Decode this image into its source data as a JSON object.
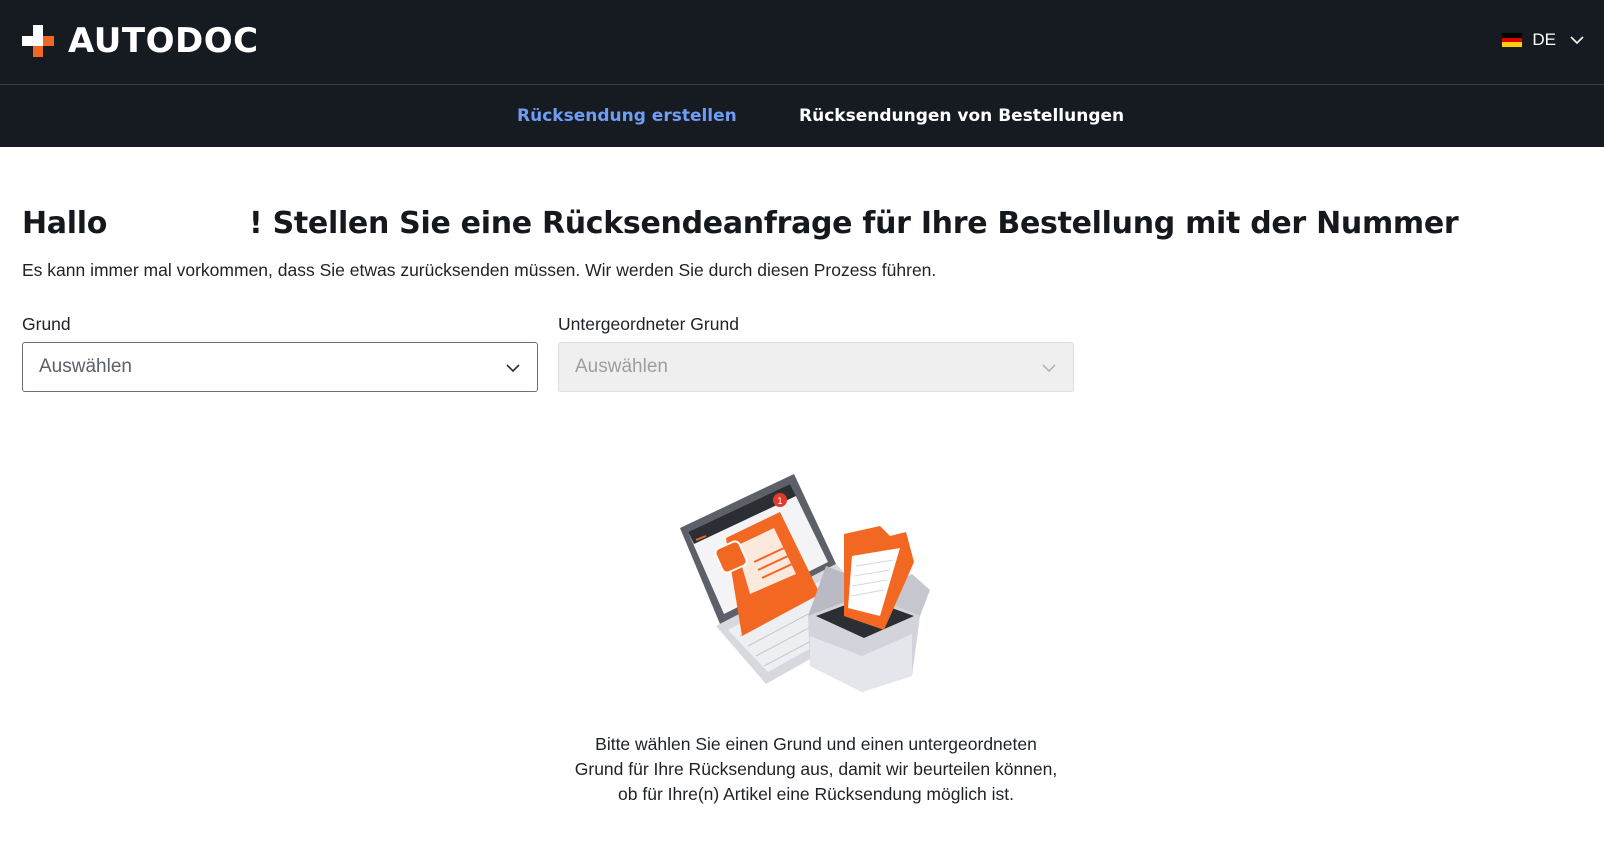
{
  "header": {
    "brand": "AUTODOC",
    "language": {
      "code": "DE",
      "flag_colors": [
        "#000000",
        "#dd0000",
        "#ffce00"
      ]
    }
  },
  "nav": {
    "items": [
      {
        "label": "Rücksendung erstellen",
        "active": true
      },
      {
        "label": "Rücksendungen von Bestellungen",
        "active": false
      }
    ]
  },
  "main": {
    "title": "Hallo              ! Stellen Sie eine Rücksendeanfrage für Ihre Bestellung mit der Nummer",
    "subtitle": "Es kann immer mal vorkommen, dass Sie etwas zurücksenden müssen. Wir werden Sie durch diesen Prozess führen.",
    "reason": {
      "label": "Grund",
      "value": "Auswählen"
    },
    "sub_reason": {
      "label": "Untergeordneter Grund",
      "value": "Auswählen",
      "disabled": true
    },
    "hint_lines": [
      "Bitte wählen Sie einen Grund und einen untergeordneten",
      "Grund für Ihre Rücksendung aus, damit wir beurteilen können,",
      "ob für Ihre(n) Artikel eine Rücksendung möglich ist."
    ],
    "illustration": {
      "badge": "1"
    }
  },
  "colors": {
    "header_bg": "#161b21",
    "brand_orange": "#f26722",
    "active_nav": "#6f9cf5"
  },
  "icons": [
    "autodoc-logo-icon",
    "germany-flag-icon",
    "chevron-down-icon"
  ]
}
